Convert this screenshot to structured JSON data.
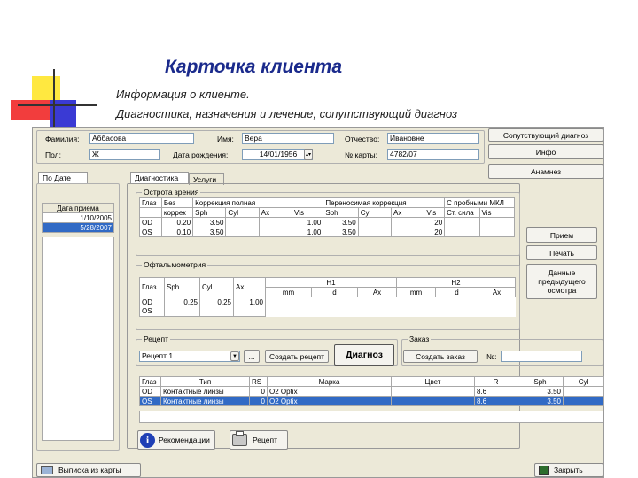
{
  "slide": {
    "title": "Карточка клиента",
    "line1": "Информация о клиенте.",
    "line2": "Диагностика, назначения и лечение, сопутствующий диагноз"
  },
  "client": {
    "surname_label": "Фамилия:",
    "surname": "Аббасова",
    "name_label": "Имя:",
    "name": "Вера",
    "patronymic_label": "Отчество:",
    "patronymic": "Ивановне",
    "sex_label": "Пол:",
    "sex": "Ж",
    "birth_label": "Дата рождения:",
    "birth": "14/01/1956",
    "card_label": "№ карты:",
    "card": "4782/07"
  },
  "side_buttons": {
    "concomitant": "Сопутствующий диагноз",
    "info": "Инфо",
    "anamnesis": "Анамнез",
    "reception": "Прием",
    "print": "Печать",
    "prev_exam": "Данные предыдущего осмотра"
  },
  "left_panel": {
    "tab": "По Дате",
    "header": "Дата приема",
    "dates": [
      "1/10/2005",
      "5/28/2007"
    ]
  },
  "tabs": {
    "diagnostics": "Диагностика",
    "services": "Услуги"
  },
  "sight": {
    "group": "Острота зрения",
    "headers": [
      "Глаз",
      "Без",
      "Коррекция полная",
      "Переносимая коррекция",
      "С пробными МКЛ"
    ],
    "sub": [
      "",
      "коррек",
      "Sph",
      "Cyl",
      "Ax",
      "Vis",
      "Sph",
      "Cyl",
      "Ax",
      "Vis",
      "Ст. сила",
      "Vis"
    ],
    "rows": [
      [
        "OD",
        "0.20",
        "3.50",
        "",
        "",
        "1.00",
        "3.50",
        "",
        "",
        "20",
        "",
        ""
      ],
      [
        "OS",
        "0.10",
        "3.50",
        "",
        "",
        "1.00",
        "3.50",
        "",
        "",
        "20",
        "",
        ""
      ]
    ]
  },
  "ophth": {
    "group": "Офтальмометрия",
    "headers": [
      "Глаз",
      "Sph",
      "Cyl",
      "Ax",
      "H1",
      "H2"
    ],
    "sub": [
      "mm",
      "d",
      "Ax",
      "mm",
      "d",
      "Ax"
    ],
    "rows": [
      [
        "OD",
        "0.25",
        "0.25",
        "1.00"
      ],
      [
        "OS",
        "",
        "",
        ""
      ]
    ]
  },
  "recipe": {
    "group": "Рецепт",
    "select": "Рецепт 1",
    "dots": "...",
    "create": "Создать рецепт",
    "diagnosis": "Диагноз"
  },
  "order": {
    "group": "Заказ",
    "create": "Создать заказ",
    "num_label": "№:"
  },
  "lens_table": {
    "headers": [
      "Глаз",
      "Тип",
      "RS",
      "Марка",
      "Цвет",
      "R",
      "Sph",
      "Cyl"
    ],
    "rows": [
      [
        "OD",
        "Контактные линзы",
        "0",
        "O2 Optix",
        "",
        "8.6",
        "3.50",
        ""
      ],
      [
        "OS",
        "Контактные линзы",
        "0",
        "O2 Optix",
        "",
        "8.6",
        "3.50",
        ""
      ]
    ]
  },
  "bottom": {
    "recommend": "Рекомендации",
    "recipe": "Рецепт",
    "extract": "Выписка из карты",
    "close": "Закрыть"
  }
}
